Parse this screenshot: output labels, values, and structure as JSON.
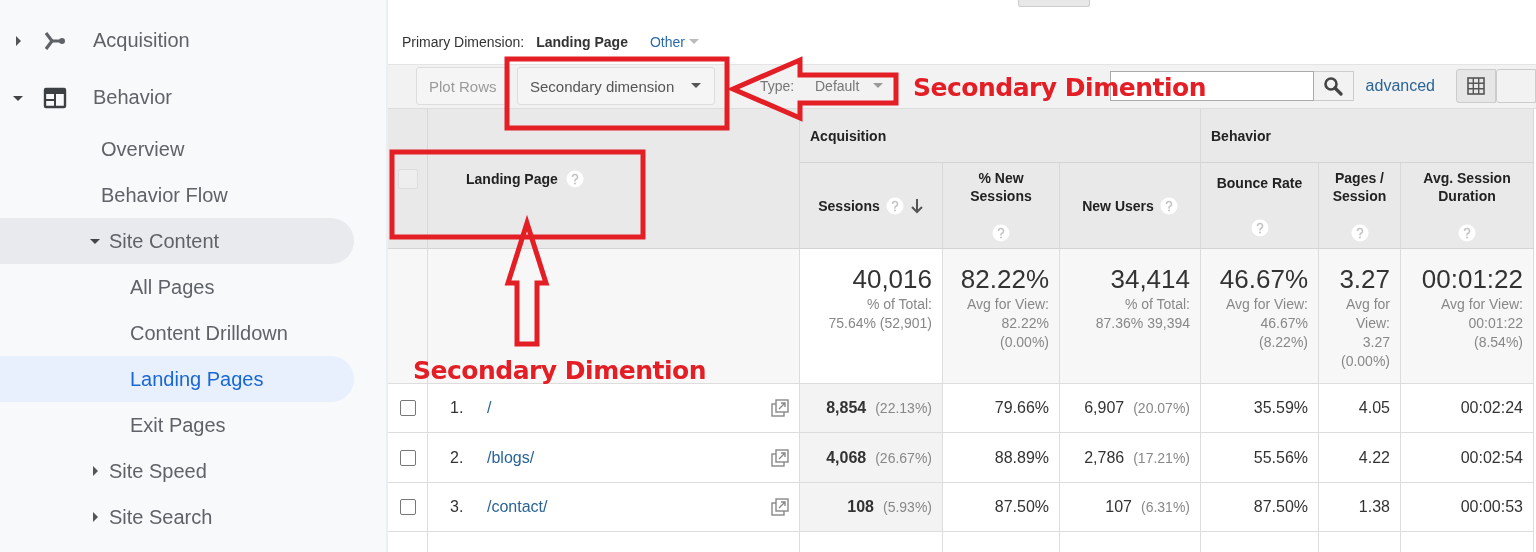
{
  "sidebar": {
    "items": [
      {
        "label": "Acquisition",
        "expanded": false,
        "selected": false
      },
      {
        "label": "Behavior",
        "expanded": true,
        "selected": false,
        "children": [
          {
            "label": "Overview",
            "selected": false
          },
          {
            "label": "Behavior Flow",
            "selected": false
          },
          {
            "label": "Site Content",
            "expanded": true,
            "selected": false,
            "children": [
              {
                "label": "All Pages",
                "selected": false
              },
              {
                "label": "Content Drilldown",
                "selected": false
              },
              {
                "label": "Landing Pages",
                "selected": true
              },
              {
                "label": "Exit Pages",
                "selected": false
              }
            ]
          },
          {
            "label": "Site Speed",
            "expanded": false,
            "selected": false
          },
          {
            "label": "Site Search",
            "expanded": false,
            "selected": false
          }
        ]
      }
    ]
  },
  "primary_dimension": {
    "label": "Primary Dimension:",
    "value": "Landing Page",
    "other": "Other"
  },
  "toolbar": {
    "plot_rows": {
      "label": "Plot Rows",
      "disabled": true
    },
    "secondary_dimension": "Secondary dimension",
    "sort_label": "Type:",
    "sort_value": "Default",
    "advanced": "advanced"
  },
  "table": {
    "all_checked": false,
    "groups": [
      {
        "label": "Acquisition"
      },
      {
        "label": "Behavior"
      }
    ],
    "columns": [
      {
        "label": "Landing Page"
      },
      {
        "label": "Sessions",
        "sorted": true
      },
      {
        "label": "% New Sessions",
        "sorted": false
      },
      {
        "label": "New Users",
        "sorted": false
      },
      {
        "label": "Bounce Rate",
        "sorted": false
      },
      {
        "label": "Pages / Session",
        "sorted": false
      },
      {
        "label": "Avg. Session Duration",
        "sorted": false
      }
    ],
    "totals": [
      {
        "value": "40,016",
        "note_lines": [
          "% of Total:",
          "75.64% (52,901)"
        ]
      },
      {
        "value": "82.22%",
        "note_lines": [
          "Avg for View:",
          "82.22%",
          "(0.00%)"
        ]
      },
      {
        "value": "34,414",
        "note_lines": [
          "% of Total:",
          "87.36% 39,394"
        ]
      },
      {
        "value": "46.67%",
        "note_lines": [
          "Avg for View:",
          "46.67%",
          "(8.22%)"
        ]
      },
      {
        "value": "3.27",
        "note_lines": [
          "Avg for",
          "View:",
          "3.27",
          "(0.00%)"
        ]
      },
      {
        "value": "00:01:22",
        "note_lines": [
          "Avg for View:",
          "00:01:22",
          "(8.54%)"
        ]
      }
    ],
    "rows": [
      {
        "checked": false,
        "number": "1.",
        "page": "/",
        "sessions": "8,854",
        "sessions_pct": "(22.13%)",
        "new_sessions_pct": "79.66%",
        "new_users": "6,907",
        "new_users_pct": "(20.07%)",
        "bounce_rate": "35.59%",
        "pages_per_session": "4.05",
        "avg_duration": "00:02:24"
      },
      {
        "checked": false,
        "number": "2.",
        "page": "/blogs/",
        "sessions": "4,068",
        "sessions_pct": "(26.67%)",
        "new_sessions_pct": "88.89%",
        "new_users": "2,786",
        "new_users_pct": "(17.21%)",
        "bounce_rate": "55.56%",
        "pages_per_session": "4.22",
        "avg_duration": "00:02:54"
      },
      {
        "checked": false,
        "number": "3.",
        "page": "/contact/",
        "sessions": "108",
        "sessions_pct": "(5.93%)",
        "new_sessions_pct": "87.50%",
        "new_users": "107",
        "new_users_pct": "(6.31%)",
        "bounce_rate": "87.50%",
        "pages_per_session": "1.38",
        "avg_duration": "00:00:53"
      }
    ]
  },
  "annotations": [
    {
      "text": "Secondary Dimention"
    },
    {
      "text": "Secondary Dimention"
    }
  ]
}
